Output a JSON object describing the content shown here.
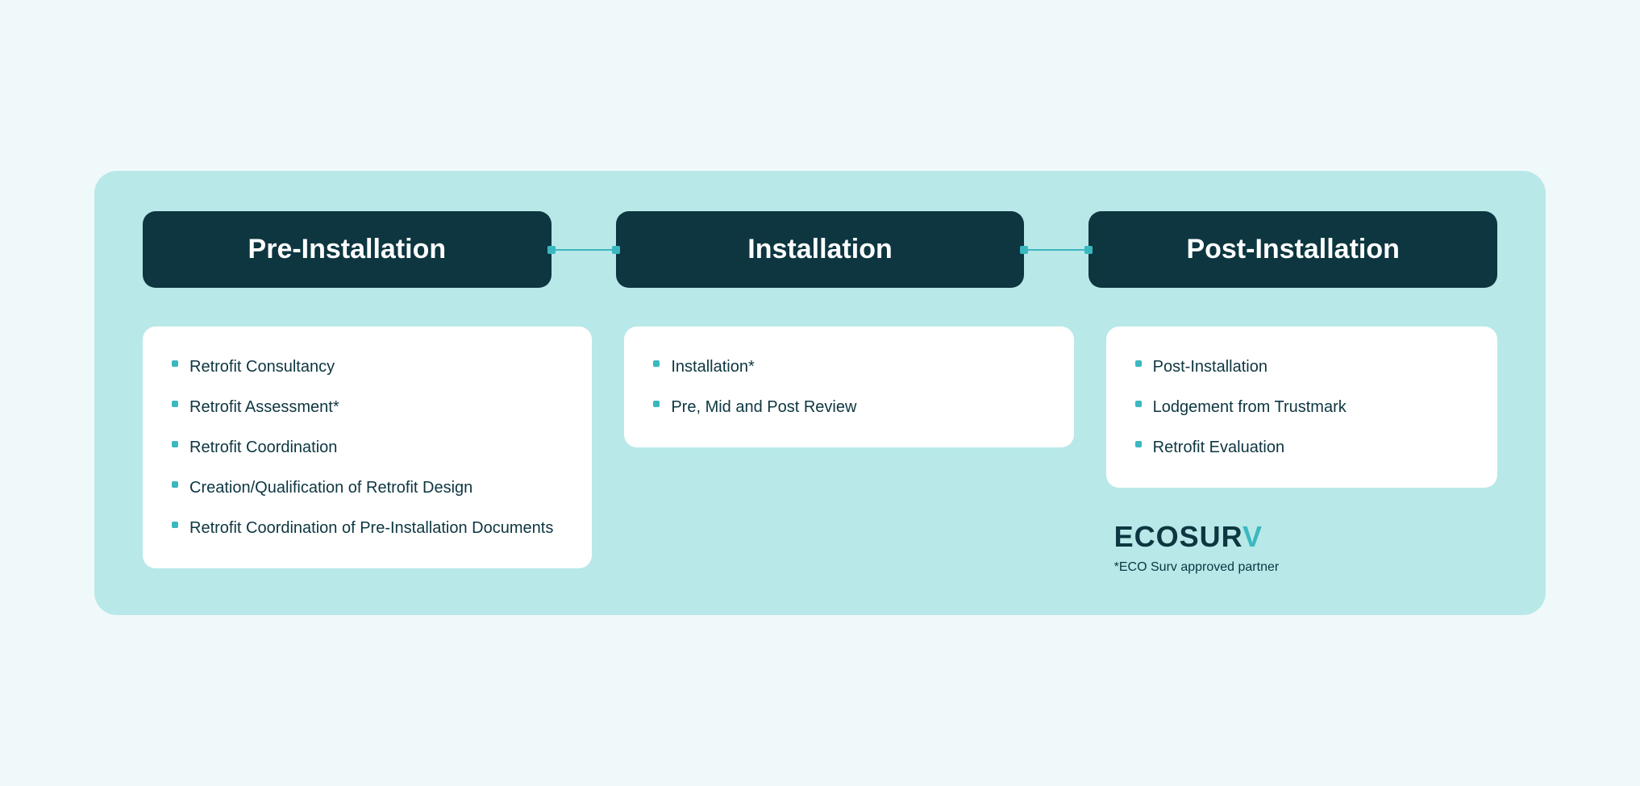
{
  "phases": [
    {
      "id": "pre-installation",
      "label": "Pre-Installation"
    },
    {
      "id": "installation",
      "label": "Installation"
    },
    {
      "id": "post-installation",
      "label": "Post-Installation"
    }
  ],
  "pre_installation_items": [
    "Retrofit Consultancy",
    "Retrofit Assessment*",
    "Retrofit Coordination",
    "Creation/Qualification of Retrofit Design",
    "Retrofit Coordination of Pre-Installation Documents"
  ],
  "installation_items": [
    "Installation*",
    "Pre, Mid and Post Review"
  ],
  "post_installation_items": [
    "Post-Installation",
    "Lodgement from Trustmark",
    "Retrofit Evaluation"
  ],
  "logo": {
    "text_main": "ECOSUR",
    "text_accent": "V",
    "note": "*ECO Surv approved partner"
  }
}
